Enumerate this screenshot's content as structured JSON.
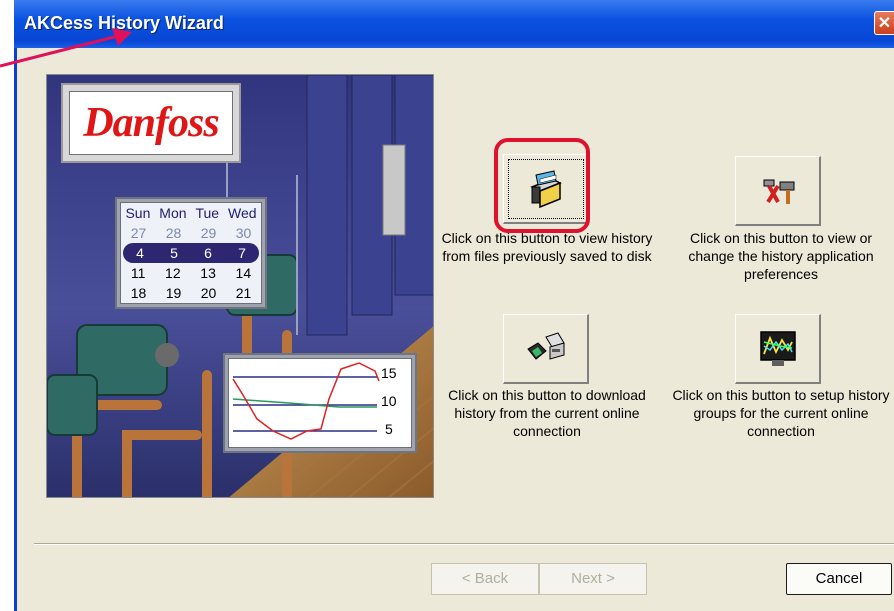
{
  "window": {
    "title": "AKCess History Wizard",
    "close_glyph": "✕"
  },
  "calendar": {
    "headers": [
      "Sun",
      "Mon",
      "Tue",
      "Wed"
    ],
    "rows": [
      [
        "27",
        "28",
        "29",
        "30"
      ],
      [
        "4",
        "5",
        "6",
        "7"
      ],
      [
        "11",
        "12",
        "13",
        "14"
      ],
      [
        "18",
        "19",
        "20",
        "21"
      ]
    ]
  },
  "logo_text": "Danfoss",
  "trend": {
    "labels": [
      "15",
      "10",
      "5"
    ]
  },
  "options": [
    {
      "id": "view-files",
      "icon": "file-cabinet-icon",
      "text": "Click on this button to view history from files previously saved to disk"
    },
    {
      "id": "preferences",
      "icon": "tools-icon",
      "text": "Click on this button to view or change the history application preferences"
    },
    {
      "id": "download",
      "icon": "network-download-icon",
      "text": "Click on this button to download history from the current online connection"
    },
    {
      "id": "groups",
      "icon": "graph-monitor-icon",
      "text": "Click on this button to setup history groups for the current online connection"
    }
  ],
  "buttons": {
    "back": "< Back",
    "next": "Next >",
    "cancel": "Cancel"
  },
  "colors": {
    "title_bar": "#0a52e0",
    "highlight": "#e0102f",
    "arrow": "#e0105a"
  }
}
